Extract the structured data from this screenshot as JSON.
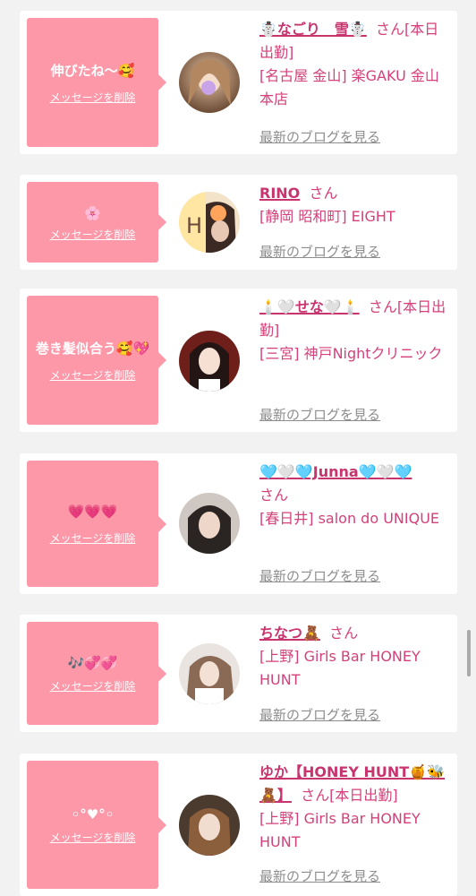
{
  "cards": [
    {
      "message": "伸びたね〜🥰",
      "delete_label": "メッセージを削除",
      "name": "☃️なごり　雪☃️",
      "suffix": "さん[本日出勤]",
      "shop": "[名古屋 金山] 楽GAKU 金山本店",
      "blog_label": "最新のブログを見る"
    },
    {
      "message": "🌸",
      "delete_label": "メッセージを削除",
      "name": "RINO",
      "suffix": "さん",
      "shop": "[静岡 昭和町] EIGHT",
      "blog_label": "最新のブログを見る"
    },
    {
      "message": "巻き髪似合う🥰💖",
      "delete_label": "メッセージを削除",
      "name": "🕯️🤍せな🤍🕯️",
      "suffix": "さん[本日出勤]",
      "shop": "[三宮] 神戸Nightクリニック",
      "blog_label": "最新のブログを見る"
    },
    {
      "message": "💗💗💗",
      "delete_label": "メッセージを削除",
      "name": "🩵🤍🩵Junna🩵🤍🩵",
      "suffix": "さん",
      "shop": "[春日井] salon do UNIQUE",
      "blog_label": "最新のブログを見る"
    },
    {
      "message": "🎶💞💞",
      "delete_label": "メッセージを削除",
      "name": "ちなつ🧸",
      "suffix": "さん",
      "shop": "[上野] Girls Bar HONEY HUNT",
      "blog_label": "最新のブログを見る"
    },
    {
      "message": "◦°♥°◦",
      "delete_label": "メッセージを削除",
      "name": "ゆか【HONEY HUNT🍯🐝🧸】",
      "suffix": "さん[本日出勤]",
      "shop": "[上野] Girls Bar HONEY HUNT",
      "blog_label": "最新のブログを見る"
    }
  ],
  "colors": {
    "background": "#f3f2f2",
    "bubble": "#fd98a9",
    "name": "#c8346e",
    "text_pink": "#d4417a",
    "blog_link": "#8d8d8d"
  }
}
